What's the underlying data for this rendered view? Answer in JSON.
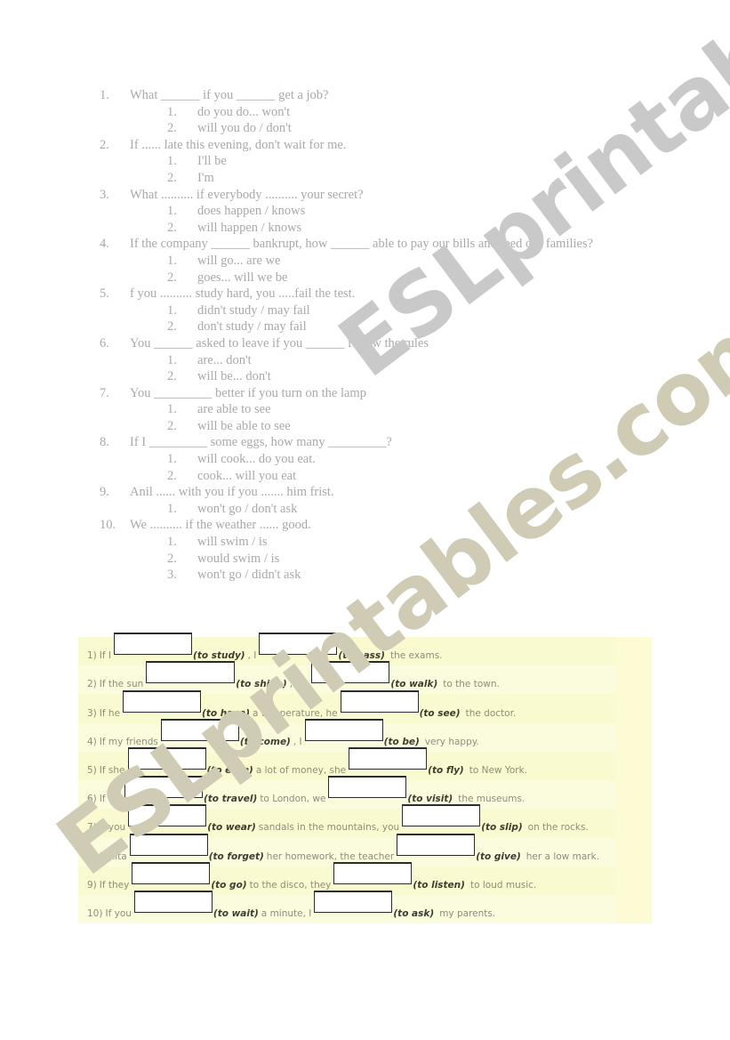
{
  "watermark": {
    "line1": "ESLprintables.com",
    "line2": "ESLprintables.com",
    "color": "#c9c9c9"
  },
  "multiple_choice": {
    "questions": [
      {
        "num": "1.",
        "text": "What ______ if you ______ get a job?",
        "options": [
          {
            "num": "1.",
            "text": "do you do... won't"
          },
          {
            "num": "2.",
            "text": "will you do / don't"
          }
        ]
      },
      {
        "num": "2.",
        "text": "If ...... late this evening, don't wait for me.",
        "options": [
          {
            "num": "1.",
            "text": "I'll be"
          },
          {
            "num": "2.",
            "text": "I'm"
          }
        ]
      },
      {
        "num": "3.",
        "text": "What .......... if everybody .......... your secret?",
        "options": [
          {
            "num": "1.",
            "text": "does happen / knows"
          },
          {
            "num": "2.",
            "text": "will happen / knows"
          }
        ]
      },
      {
        "num": "4.",
        "text": "If the company ______ bankrupt, how ______ able to pay our bills and feed our families?",
        "options": [
          {
            "num": "1.",
            "text": "will go... are we"
          },
          {
            "num": "2.",
            "text": "goes... will we be"
          }
        ]
      },
      {
        "num": "5.",
        "text": "f you .......... study hard, you .....fail the test.",
        "options": [
          {
            "num": "1.",
            "text": "didn't study / may fail"
          },
          {
            "num": "2.",
            "text": "don't study / may fail"
          }
        ]
      },
      {
        "num": "6.",
        "text": "You ______ asked to leave if you ______ follow the rules",
        "options": [
          {
            "num": "1.",
            "text": "are... don't"
          },
          {
            "num": "2.",
            "text": "will be... don't"
          }
        ]
      },
      {
        "num": "7.",
        "text": "You _________ better if you turn on the lamp",
        "options": [
          {
            "num": "1.",
            "text": "are able to see"
          },
          {
            "num": "2.",
            "text": "will be able to see"
          }
        ]
      },
      {
        "num": "8.",
        "text": "If I _________ some eggs, how many _________?",
        "options": [
          {
            "num": "1.",
            "text": "will cook... do you eat."
          },
          {
            "num": "2.",
            "text": "cook... will you eat"
          }
        ]
      },
      {
        "num": "9.",
        "text": "Anil ...... with you if you ....... him frist.",
        "options": [
          {
            "num": "1.",
            "text": "won't go / don't ask"
          }
        ]
      },
      {
        "num": "10.",
        "text": "We .......... if the weather ...... good.",
        "options": [
          {
            "num": "1.",
            "text": "will swim / is"
          },
          {
            "num": "2.",
            "text": "would swim / is"
          },
          {
            "num": "3.",
            "text": "won't go / didn't ask"
          }
        ]
      }
    ]
  },
  "fill_in_exercise": {
    "background_color": "#fafad0",
    "rows": [
      {
        "num": "1)",
        "lead": "If I",
        "verb1": "(to study)",
        "mid": ", I",
        "verb2": "(to pass)",
        "tail": "the exams."
      },
      {
        "num": "2)",
        "lead": "If the sun",
        "verb1": "(to shine)",
        "mid": ", we",
        "verb2": "(to walk)",
        "tail": "to the town."
      },
      {
        "num": "3)",
        "lead": "If he",
        "verb1": "(to have)",
        "mid": "a temperature, he",
        "verb2": "(to see)",
        "tail": "the doctor."
      },
      {
        "num": "4)",
        "lead": "If my friends",
        "verb1": "(to come)",
        "mid": ", I",
        "verb2": "(to be)",
        "tail": "very happy."
      },
      {
        "num": "5)",
        "lead": "If she",
        "verb1": "(to earn)",
        "mid": "a lot of money, she",
        "verb2": "(to fly)",
        "tail": "to New York."
      },
      {
        "num": "6)",
        "lead": "If we",
        "verb1": "(to travel)",
        "mid": "to London, we",
        "verb2": "(to visit)",
        "tail": "the museums."
      },
      {
        "num": "7)",
        "lead": "If you",
        "verb1": "(to wear)",
        "mid": "sandals in the mountains, you",
        "verb2": "(to slip)",
        "tail": "on the rocks."
      },
      {
        "num": "8)",
        "lead": "If Rita",
        "verb1": "(to forget)",
        "mid": "her homework, the teacher",
        "verb2": "(to give)",
        "tail": "her a low mark."
      },
      {
        "num": "9)",
        "lead": "If they",
        "verb1": "(to go)",
        "mid": "to the disco, they",
        "verb2": "(to listen)",
        "tail": "to loud music."
      },
      {
        "num": "10)",
        "lead": "If you",
        "verb1": "(to wait)",
        "mid": "a minute, I",
        "verb2": "(to ask)",
        "tail": "my parents."
      }
    ],
    "answer_values": [
      "",
      "",
      "",
      "",
      "",
      "",
      "",
      "",
      "",
      "",
      "",
      "",
      "",
      "",
      "",
      "",
      "",
      "",
      "",
      ""
    ]
  }
}
